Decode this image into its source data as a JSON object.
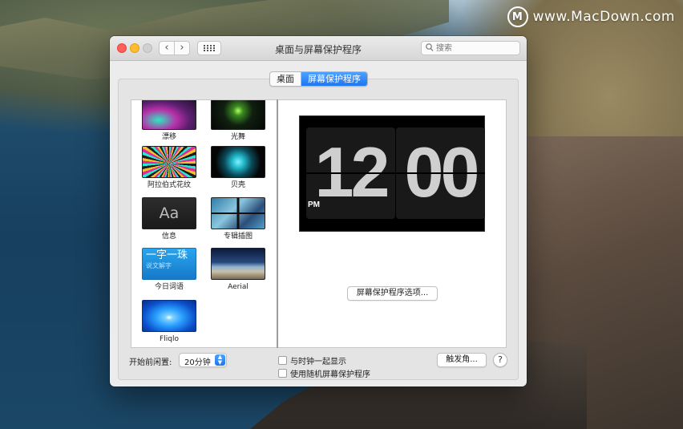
{
  "watermark": {
    "logo_letter": "M",
    "text": "www.MacDown.com"
  },
  "window": {
    "title": "桌面与屏幕保护程序",
    "search_placeholder": "搜索",
    "nav_back": "‹",
    "nav_forward": "›"
  },
  "tabs": [
    {
      "label": "桌面",
      "active": false
    },
    {
      "label": "屏幕保护程序",
      "active": true
    }
  ],
  "savers": [
    {
      "label": "漂移",
      "icon": "drift-thumbnail"
    },
    {
      "label": "光舞",
      "icon": "flurry-thumbnail"
    },
    {
      "label": "阿拉伯式花纹",
      "icon": "arabesque-thumbnail"
    },
    {
      "label": "贝壳",
      "icon": "shell-thumbnail"
    },
    {
      "label": "信息",
      "icon": "message-thumbnail",
      "thumb_text": "Aa"
    },
    {
      "label": "专辑插图",
      "icon": "album-artwork-thumbnail"
    },
    {
      "label": "今日词语",
      "icon": "word-of-day-thumbnail",
      "thumb_text": "一字一珠",
      "thumb_sub": "说文解字"
    },
    {
      "label": "Aerial",
      "icon": "aerial-thumbnail"
    },
    {
      "label": "Fliqlo",
      "icon": "fliqlo-thumbnail"
    }
  ],
  "preview": {
    "hour": "12",
    "minute": "00",
    "ampm": "PM"
  },
  "options_button": "屏幕保护程序选项...",
  "start_after": {
    "label": "开始前闲置:",
    "value": "20分钟"
  },
  "checkboxes": [
    {
      "label": "与时钟一起显示",
      "checked": false
    },
    {
      "label": "使用随机屏幕保护程序",
      "checked": false
    }
  ],
  "hot_corners_button": "触发角...",
  "help_button": "?",
  "colors": {
    "accent": "#1c77f2",
    "close": "#fe5f57",
    "minimize": "#febc2e"
  }
}
